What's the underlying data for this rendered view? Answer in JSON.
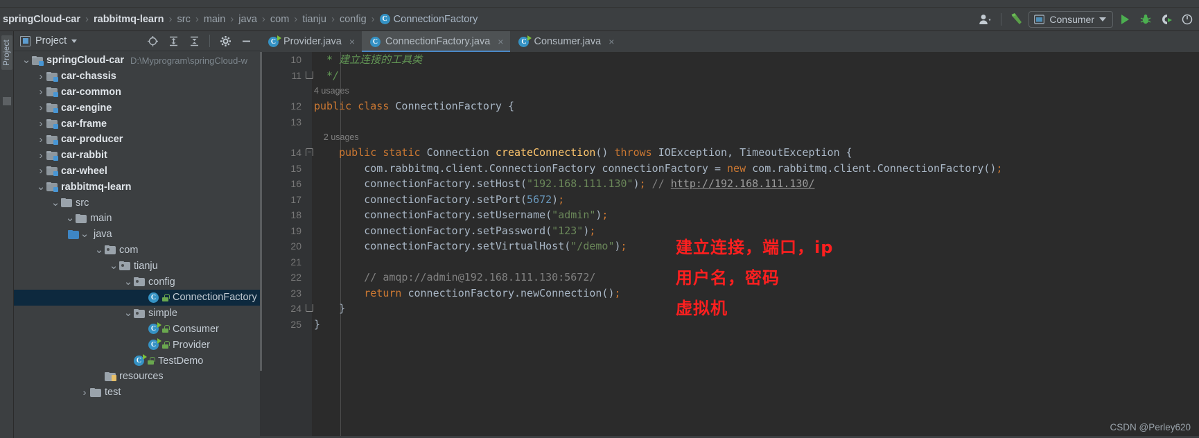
{
  "window": {
    "accent_blue": "#4a88c7",
    "bg": "#3c3f41",
    "editor_bg": "#2b2b2b",
    "selection_blue": "#0d293e",
    "annotation_red": "#ff1f1f"
  },
  "breadcrumb": {
    "items": [
      {
        "label": "springCloud-car",
        "style": "bold"
      },
      {
        "label": "rabbitmq-learn",
        "style": "bold"
      },
      {
        "label": "src",
        "style": "dim"
      },
      {
        "label": "main",
        "style": "dim"
      },
      {
        "label": "java",
        "style": "dim"
      },
      {
        "label": "com",
        "style": "dim"
      },
      {
        "label": "tianju",
        "style": "dim"
      },
      {
        "label": "config",
        "style": "dim"
      },
      {
        "label": "ConnectionFactory",
        "style": "class",
        "icon": "class-icon"
      }
    ],
    "separator": "›"
  },
  "toolbar": {
    "avatar_icon": "user-icon",
    "build_icon": "hammer-icon",
    "run_config": {
      "label": "Consumer",
      "icon": "run-config-icon",
      "caret": "chevron-down-icon"
    },
    "run_icon": "run-play-icon",
    "debug_icon": "debug-bug-icon",
    "run_coverage_icon": "run-with-coverage-icon",
    "more_icon": "more-icon"
  },
  "left_strip": {
    "vertical_tab": "Project"
  },
  "project_panel": {
    "title": "Project",
    "title_caret": "chevron-down-icon",
    "icons": [
      "locate-icon",
      "expand-all-icon",
      "collapse-all-icon",
      "settings-gear-icon",
      "hide-icon"
    ],
    "tree": [
      {
        "depth": 0,
        "arrow": "v",
        "icon": "module-folder-icon",
        "label": "springCloud-car",
        "bold": true,
        "path": "D:\\Myprogram\\springCloud-w"
      },
      {
        "depth": 1,
        "arrow": ">",
        "icon": "module-folder-icon",
        "label": "car-chassis",
        "bold": true
      },
      {
        "depth": 1,
        "arrow": ">",
        "icon": "module-folder-icon",
        "label": "car-common",
        "bold": true
      },
      {
        "depth": 1,
        "arrow": ">",
        "icon": "module-folder-icon",
        "label": "car-engine",
        "bold": true
      },
      {
        "depth": 1,
        "arrow": ">",
        "icon": "module-folder-icon",
        "label": "car-frame",
        "bold": true
      },
      {
        "depth": 1,
        "arrow": ">",
        "icon": "module-folder-icon",
        "label": "car-producer",
        "bold": true
      },
      {
        "depth": 1,
        "arrow": ">",
        "icon": "module-folder-icon",
        "label": "car-rabbit",
        "bold": true
      },
      {
        "depth": 1,
        "arrow": ">",
        "icon": "module-folder-icon",
        "label": "car-wheel",
        "bold": true
      },
      {
        "depth": 1,
        "arrow": "v",
        "icon": "module-folder-icon",
        "label": "rabbitmq-learn",
        "bold": true
      },
      {
        "depth": 2,
        "arrow": "v",
        "icon": "folder-icon",
        "label": "src"
      },
      {
        "depth": 3,
        "arrow": "v",
        "icon": "folder-icon",
        "label": "main"
      },
      {
        "depth": 4,
        "arrow": "v",
        "icon": "source-folder-icon",
        "label": "java"
      },
      {
        "depth": 5,
        "arrow": "v",
        "icon": "package-icon",
        "label": "com"
      },
      {
        "depth": 6,
        "arrow": "v",
        "icon": "package-icon",
        "label": "tianju"
      },
      {
        "depth": 7,
        "arrow": "v",
        "icon": "package-icon",
        "label": "config"
      },
      {
        "depth": 8,
        "arrow": "",
        "icon": "class-icon",
        "label": "ConnectionFactory",
        "selected": true,
        "lock": true
      },
      {
        "depth": 7,
        "arrow": "v",
        "icon": "package-icon",
        "label": "simple"
      },
      {
        "depth": 8,
        "arrow": "",
        "icon": "runnable-class-icon",
        "label": "Consumer",
        "lock": true
      },
      {
        "depth": 8,
        "arrow": "",
        "icon": "runnable-class-icon",
        "label": "Provider",
        "lock": true
      },
      {
        "depth": 7,
        "arrow": "",
        "icon": "runnable-class-icon",
        "label": "TestDemo",
        "lock": true
      },
      {
        "depth": 5,
        "arrow": "",
        "icon": "resources-folder-icon",
        "label": "resources"
      },
      {
        "depth": 4,
        "arrow": ">",
        "icon": "folder-icon",
        "label": "test"
      }
    ]
  },
  "editor": {
    "tabs": [
      {
        "label": "Provider.java",
        "icon": "runnable-class-icon",
        "active": false,
        "close": "×"
      },
      {
        "label": "ConnectionFactory.java",
        "icon": "class-icon",
        "active": true,
        "close": "×"
      },
      {
        "label": "Consumer.java",
        "icon": "runnable-class-icon",
        "active": false,
        "close": "×"
      }
    ],
    "lines": [
      {
        "num": "10",
        "fold": "",
        "tokens": [
          {
            "t": "  * 建立连接的工具类",
            "c": "cmt-doc"
          }
        ]
      },
      {
        "num": "11",
        "fold": "bot",
        "tokens": [
          {
            "t": "  */",
            "c": "cmt-doc"
          }
        ]
      },
      {
        "num": "",
        "usage": "4 usages"
      },
      {
        "num": "12",
        "fold": "",
        "tokens": [
          {
            "t": "public ",
            "c": "kw"
          },
          {
            "t": "class ",
            "c": "kw"
          },
          {
            "t": "ConnectionFactory",
            "c": "typ"
          },
          {
            "t": " {",
            "c": "pun"
          }
        ]
      },
      {
        "num": "13",
        "fold": "",
        "tokens": []
      },
      {
        "num": "",
        "usage": "    2 usages"
      },
      {
        "num": "14",
        "fold": "top",
        "tokens": [
          {
            "t": "    public ",
            "c": "kw"
          },
          {
            "t": "static ",
            "c": "kw"
          },
          {
            "t": "Connection ",
            "c": "typ"
          },
          {
            "t": "createConnection",
            "c": "mth"
          },
          {
            "t": "() ",
            "c": "pun"
          },
          {
            "t": "throws ",
            "c": "kw"
          },
          {
            "t": "IOException, TimeoutException {",
            "c": "typ"
          }
        ]
      },
      {
        "num": "15",
        "fold": "",
        "tokens": [
          {
            "t": "        com.rabbitmq.client.ConnectionFactory connectionFactory = ",
            "c": "typ"
          },
          {
            "t": "new ",
            "c": "kw"
          },
          {
            "t": "com.rabbitmq.client.ConnectionFactory()",
            "c": "typ"
          },
          {
            "t": ";",
            "c": "semi"
          }
        ]
      },
      {
        "num": "16",
        "fold": "",
        "tokens": [
          {
            "t": "        connectionFactory.setHost(",
            "c": "typ"
          },
          {
            "t": "\"192.168.111.130\"",
            "c": "str"
          },
          {
            "t": ")",
            "c": "pun"
          },
          {
            "t": ";",
            "c": "semi"
          },
          {
            "t": " // ",
            "c": "cmt"
          },
          {
            "t": "http://192.168.111.130/",
            "c": "lnk"
          }
        ]
      },
      {
        "num": "17",
        "fold": "",
        "tokens": [
          {
            "t": "        connectionFactory.setPort(",
            "c": "typ"
          },
          {
            "t": "5672",
            "c": "num"
          },
          {
            "t": ")",
            "c": "pun"
          },
          {
            "t": ";",
            "c": "semi"
          }
        ]
      },
      {
        "num": "18",
        "fold": "",
        "tokens": [
          {
            "t": "        connectionFactory.setUsername(",
            "c": "typ"
          },
          {
            "t": "\"admin\"",
            "c": "str"
          },
          {
            "t": ")",
            "c": "pun"
          },
          {
            "t": ";",
            "c": "semi"
          }
        ]
      },
      {
        "num": "19",
        "fold": "",
        "tokens": [
          {
            "t": "        connectionFactory.setPassword(",
            "c": "typ"
          },
          {
            "t": "\"123\"",
            "c": "str"
          },
          {
            "t": ")",
            "c": "pun"
          },
          {
            "t": ";",
            "c": "semi"
          }
        ]
      },
      {
        "num": "20",
        "fold": "",
        "tokens": [
          {
            "t": "        connectionFactory.setVirtualHost(",
            "c": "typ"
          },
          {
            "t": "\"/demo\"",
            "c": "str"
          },
          {
            "t": ")",
            "c": "pun"
          },
          {
            "t": ";",
            "c": "semi"
          }
        ]
      },
      {
        "num": "21",
        "fold": "",
        "tokens": []
      },
      {
        "num": "22",
        "fold": "",
        "tokens": [
          {
            "t": "        // amqp://admin@192.168.111.130:5672/",
            "c": "cmt"
          }
        ]
      },
      {
        "num": "23",
        "fold": "",
        "tokens": [
          {
            "t": "        return ",
            "c": "kw"
          },
          {
            "t": "connectionFactory.newConnection()",
            "c": "typ"
          },
          {
            "t": ";",
            "c": "semi"
          }
        ]
      },
      {
        "num": "24",
        "fold": "bot",
        "tokens": [
          {
            "t": "    }",
            "c": "pun"
          }
        ]
      },
      {
        "num": "25",
        "fold": "",
        "tokens": [
          {
            "t": "}",
            "c": "pun"
          }
        ]
      }
    ]
  },
  "annotation": {
    "lines": [
      "建立连接，端口，ip",
      "用户名，密码",
      "虚拟机"
    ]
  },
  "watermark": "CSDN @Perley620"
}
